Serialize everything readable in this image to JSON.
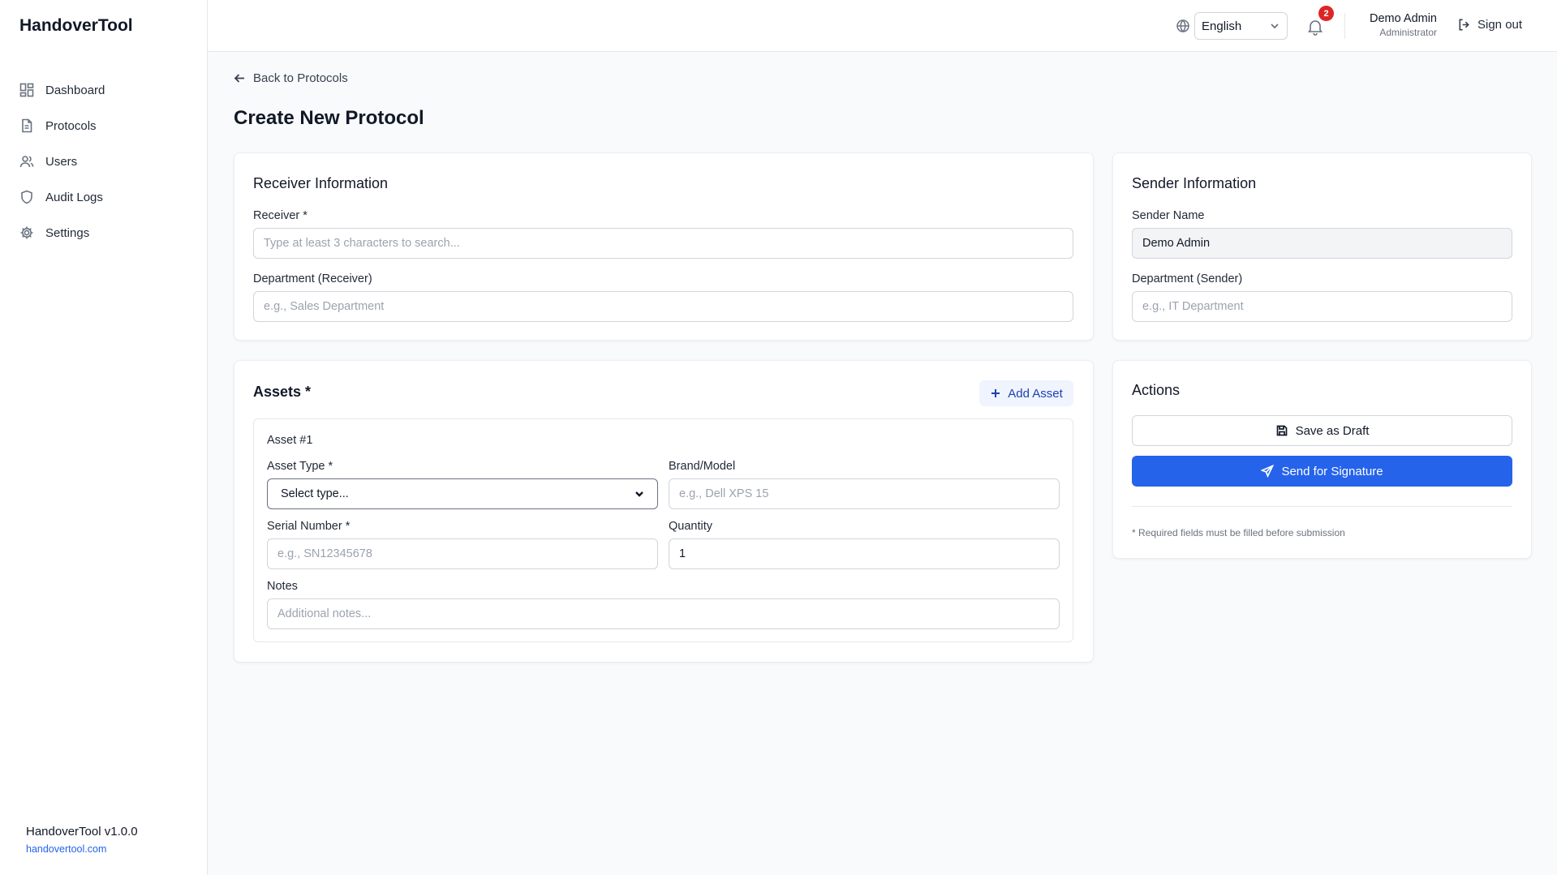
{
  "app": {
    "name": "HandoverTool",
    "version": "HandoverTool v1.0.0",
    "site": "handovertool.com"
  },
  "sidebar": {
    "items": [
      {
        "label": "Dashboard",
        "icon": "dashboard-icon"
      },
      {
        "label": "Protocols",
        "icon": "document-icon"
      },
      {
        "label": "Users",
        "icon": "users-icon"
      },
      {
        "label": "Audit Logs",
        "icon": "shield-icon"
      },
      {
        "label": "Settings",
        "icon": "gear-icon"
      }
    ]
  },
  "header": {
    "language": "English",
    "notifications_count": "2",
    "user_name": "Demo Admin",
    "user_role": "Administrator",
    "sign_out": "Sign out"
  },
  "page": {
    "back_link": "Back to Protocols",
    "title": "Create New Protocol"
  },
  "receiver": {
    "title": "Receiver Information",
    "receiver_label": "Receiver *",
    "receiver_placeholder": "Type at least 3 characters to search...",
    "department_label": "Department (Receiver)",
    "department_placeholder": "e.g., Sales Department"
  },
  "sender": {
    "title": "Sender Information",
    "name_label": "Sender Name",
    "name_value": "Demo Admin",
    "department_label": "Department (Sender)",
    "department_placeholder": "e.g., IT Department"
  },
  "assets": {
    "title": "Assets *",
    "add_button": "Add Asset",
    "items": [
      {
        "heading": "Asset #1",
        "type_label": "Asset Type *",
        "type_value": "Select type...",
        "brand_label": "Brand/Model",
        "brand_placeholder": "e.g., Dell XPS 15",
        "serial_label": "Serial Number *",
        "serial_placeholder": "e.g., SN12345678",
        "quantity_label": "Quantity",
        "quantity_value": "1",
        "notes_label": "Notes",
        "notes_placeholder": "Additional notes..."
      }
    ]
  },
  "actions": {
    "title": "Actions",
    "save_draft": "Save as Draft",
    "send_signature": "Send for Signature",
    "note": "* Required fields must be filled before submission"
  },
  "colors": {
    "primary": "#2563eb",
    "badge": "#dc2626",
    "accent_bg": "#eff4ff"
  }
}
